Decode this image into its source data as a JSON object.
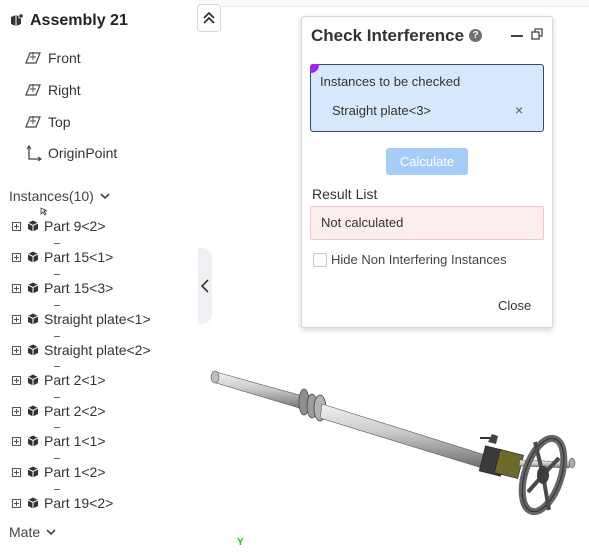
{
  "tree": {
    "assembly_title": "Assembly 21",
    "planes": [
      {
        "label": "Front",
        "icon": "plane-icon"
      },
      {
        "label": "Right",
        "icon": "plane-icon"
      },
      {
        "label": "Top",
        "icon": "plane-icon"
      },
      {
        "label": "OriginPoint",
        "icon": "origin-icon"
      }
    ],
    "instances_header": "Instances(10)",
    "instances": [
      "Part 9<2>",
      "Part 15<1>",
      "Part 15<3>",
      "Straight plate<1>",
      "Straight plate<2>",
      "Part 2<1>",
      "Part 2<2>",
      "Part 1<1>",
      "Part 1<2>",
      "Part 19<2>"
    ],
    "mate_header": "Mate"
  },
  "dialog": {
    "title": "Check Interference",
    "help_glyph": "?",
    "selection_caption": "Instances to be checked",
    "selected_item": "Straight plate<3>",
    "remove_glyph": "×",
    "calculate_label": "Calculate",
    "result_label": "Result List",
    "result_text": "Not calculated",
    "hide_checkbox_label": "Hide Non Interfering Instances",
    "hide_checked": false,
    "close_label": "Close"
  },
  "viewport": {
    "axis_label": "Y",
    "axis_color": "#1fc21f"
  },
  "colors": {
    "selection_bg": "#d6e8fb",
    "selection_corner": "#9c27ef",
    "calculate_bg": "#a6cdf7",
    "result_bg": "#fdeeee"
  }
}
